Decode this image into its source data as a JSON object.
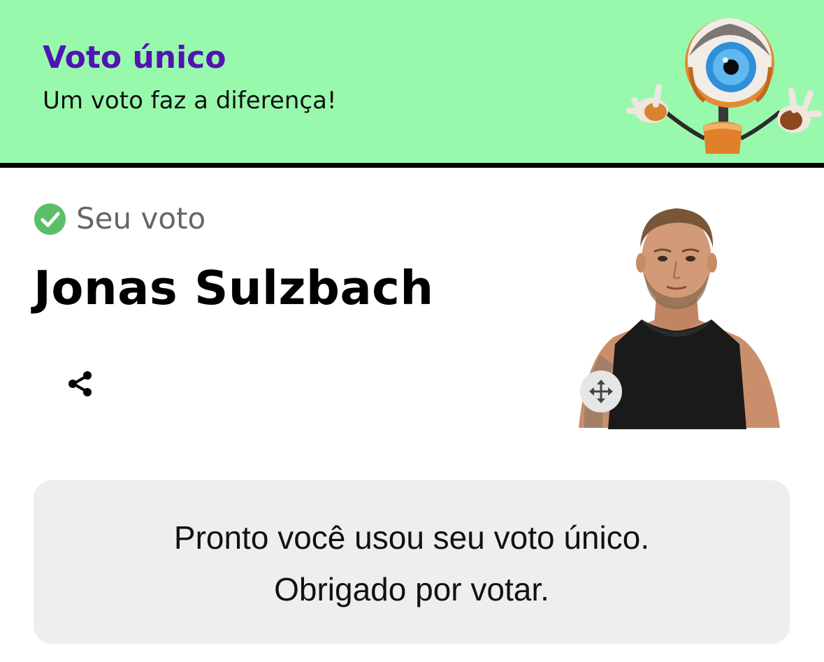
{
  "header": {
    "title": "Voto único",
    "subtitle": "Um voto faz a diferença!",
    "mascot_icon": "big-brother-eye-robot-icon",
    "background_color": "#98f9ad",
    "title_color": "#5014b4"
  },
  "vote": {
    "status_label": "Seu voto",
    "status_icon": "check-circle-icon",
    "status_color": "#5bbf6a",
    "candidate_name": "Jonas Sulzbach",
    "share_icon": "share-icon",
    "photo": "candidate-photo",
    "move_icon": "move-arrows-icon"
  },
  "notice": {
    "line1": "Pronto você usou seu voto único.",
    "line2": "Obrigado por votar."
  }
}
